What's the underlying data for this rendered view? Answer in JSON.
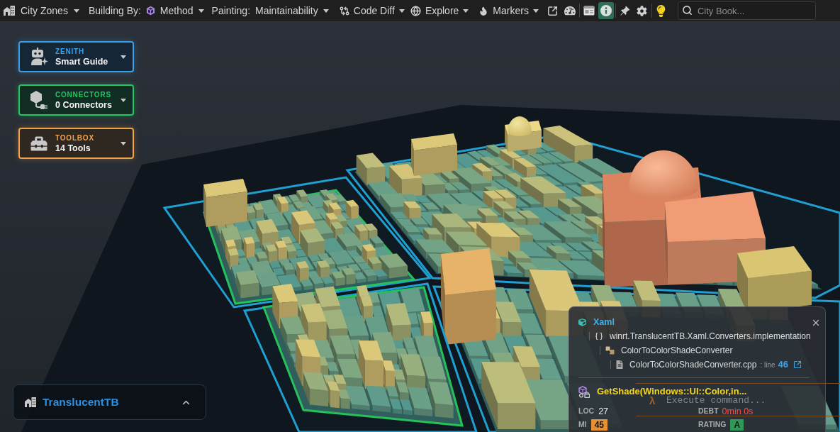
{
  "toolbar": {
    "zones_menu": {
      "label": "City Zones"
    },
    "building_by": {
      "label": "Building By:",
      "value": "Method"
    },
    "painting": {
      "label": "Painting:",
      "value": "Maintainability"
    },
    "menus": [
      {
        "kind": "diff",
        "label": "Code Diff"
      },
      {
        "kind": "explore",
        "label": "Explore"
      },
      {
        "kind": "markers",
        "label": "Markers"
      }
    ],
    "tool_groups": [
      {
        "buttons": [
          {
            "kind": "external",
            "on": false
          },
          {
            "kind": "gauge",
            "on": false
          }
        ]
      },
      {
        "buttons": [
          {
            "kind": "panel",
            "on": false
          },
          {
            "kind": "info",
            "on": true
          }
        ]
      },
      {
        "buttons": [
          {
            "kind": "pin",
            "on": false
          },
          {
            "kind": "settings",
            "on": false
          }
        ]
      },
      {
        "buttons": [
          {
            "kind": "hint",
            "on": false
          }
        ]
      }
    ],
    "search": {
      "placeholder": "City Book..."
    }
  },
  "panels": [
    {
      "kind": "guide",
      "title": "ZENITH",
      "subtitle": "Smart Guide",
      "color": "#3b9fe8"
    },
    {
      "kind": "connectors",
      "title": "CONNECTORS",
      "subtitle": "0 Connectors",
      "color": "#22c55e"
    },
    {
      "kind": "toolbox",
      "title": "TOOLBOX",
      "subtitle": "14 Tools",
      "color": "#f0a24a"
    }
  ],
  "project": {
    "name": "TranslucentTB"
  },
  "details": {
    "path": [
      {
        "kind": "module",
        "label": "Xaml",
        "children": [
          {
            "kind": "namespace",
            "label": "winrt.TranslucentTB.Xaml.Converters.implementation",
            "children": [
              {
                "kind": "class",
                "label": "ColorToColorShadeConverter",
                "children": [
                  {
                    "kind": "file",
                    "label": "ColorToColorShadeConverter.cpp",
                    "line_label": ": line",
                    "line": "46"
                  }
                ]
              }
            ]
          }
        ]
      }
    ],
    "symbol": "GetShade(Windows::UI::Color,in...",
    "metrics": [
      {
        "kind": "plain",
        "label": "LOC",
        "value": "27"
      },
      {
        "kind": "alert",
        "label": "DEBT",
        "value": "0min 0s"
      },
      {
        "kind": "badge",
        "label": "MI",
        "value": "45",
        "color": "#e8902e"
      },
      {
        "kind": "badge",
        "label": "RATING",
        "value": "A",
        "color": "#2e9a58"
      }
    ]
  },
  "command_bar": {
    "prompt": "λ",
    "placeholder": "Execute command..."
  }
}
